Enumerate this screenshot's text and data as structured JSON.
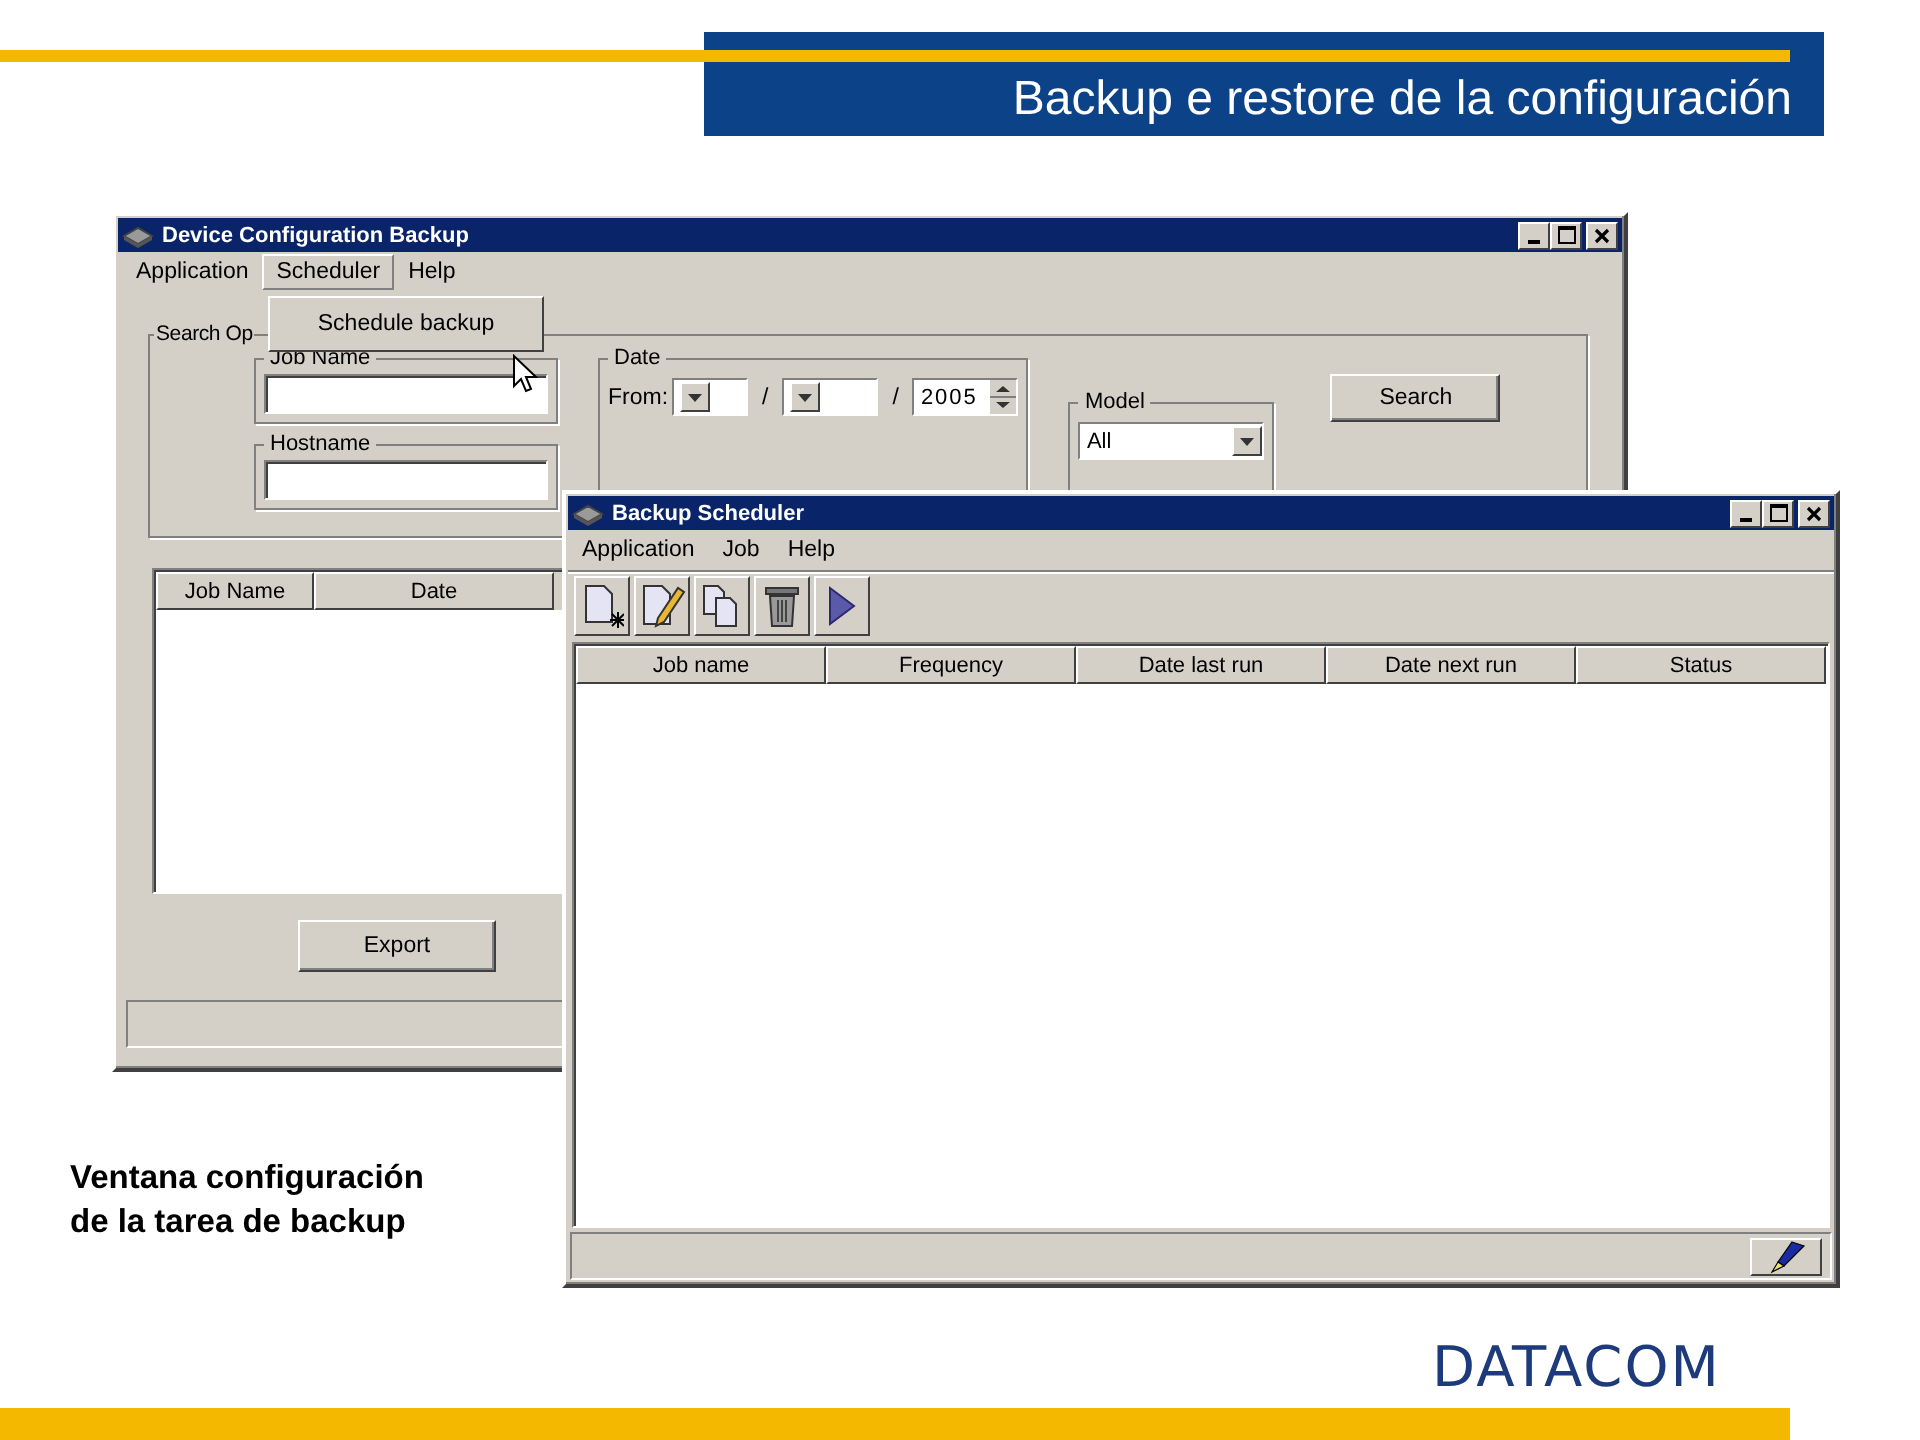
{
  "slide": {
    "title": "Backup e restore de la configuración",
    "caption": "Ventana configuración\nde la tarea de backup",
    "logo": "DATACOM"
  },
  "config_window": {
    "title": "Device Configuration Backup",
    "menu": [
      {
        "label": "Application",
        "selected": false
      },
      {
        "label": "Scheduler",
        "selected": true
      },
      {
        "label": "Help",
        "selected": false
      }
    ],
    "open_menu": [
      "Schedule backup"
    ],
    "search_group": "Search Op",
    "job_name": {
      "label": "Job Name"
    },
    "hostname": {
      "label": "Hostname"
    },
    "date": {
      "label": "Date",
      "from_label": "From:",
      "separators": [
        "/",
        "/"
      ],
      "year": "2005"
    },
    "model": {
      "label": "Model",
      "value": "All"
    },
    "search_button": "Search",
    "table_columns": [
      "Job Name",
      "Date"
    ],
    "export_button": "Export"
  },
  "scheduler_window": {
    "title": "Backup Scheduler",
    "menu": [
      "Application",
      "Job",
      "Help"
    ],
    "toolbar": [
      {
        "kind": "new"
      },
      {
        "kind": "edit"
      },
      {
        "kind": "copy"
      },
      {
        "kind": "delete"
      },
      {
        "kind": "run"
      }
    ],
    "table_columns": [
      "Job name",
      "Frequency",
      "Date last run",
      "Date next run",
      "Status"
    ]
  }
}
